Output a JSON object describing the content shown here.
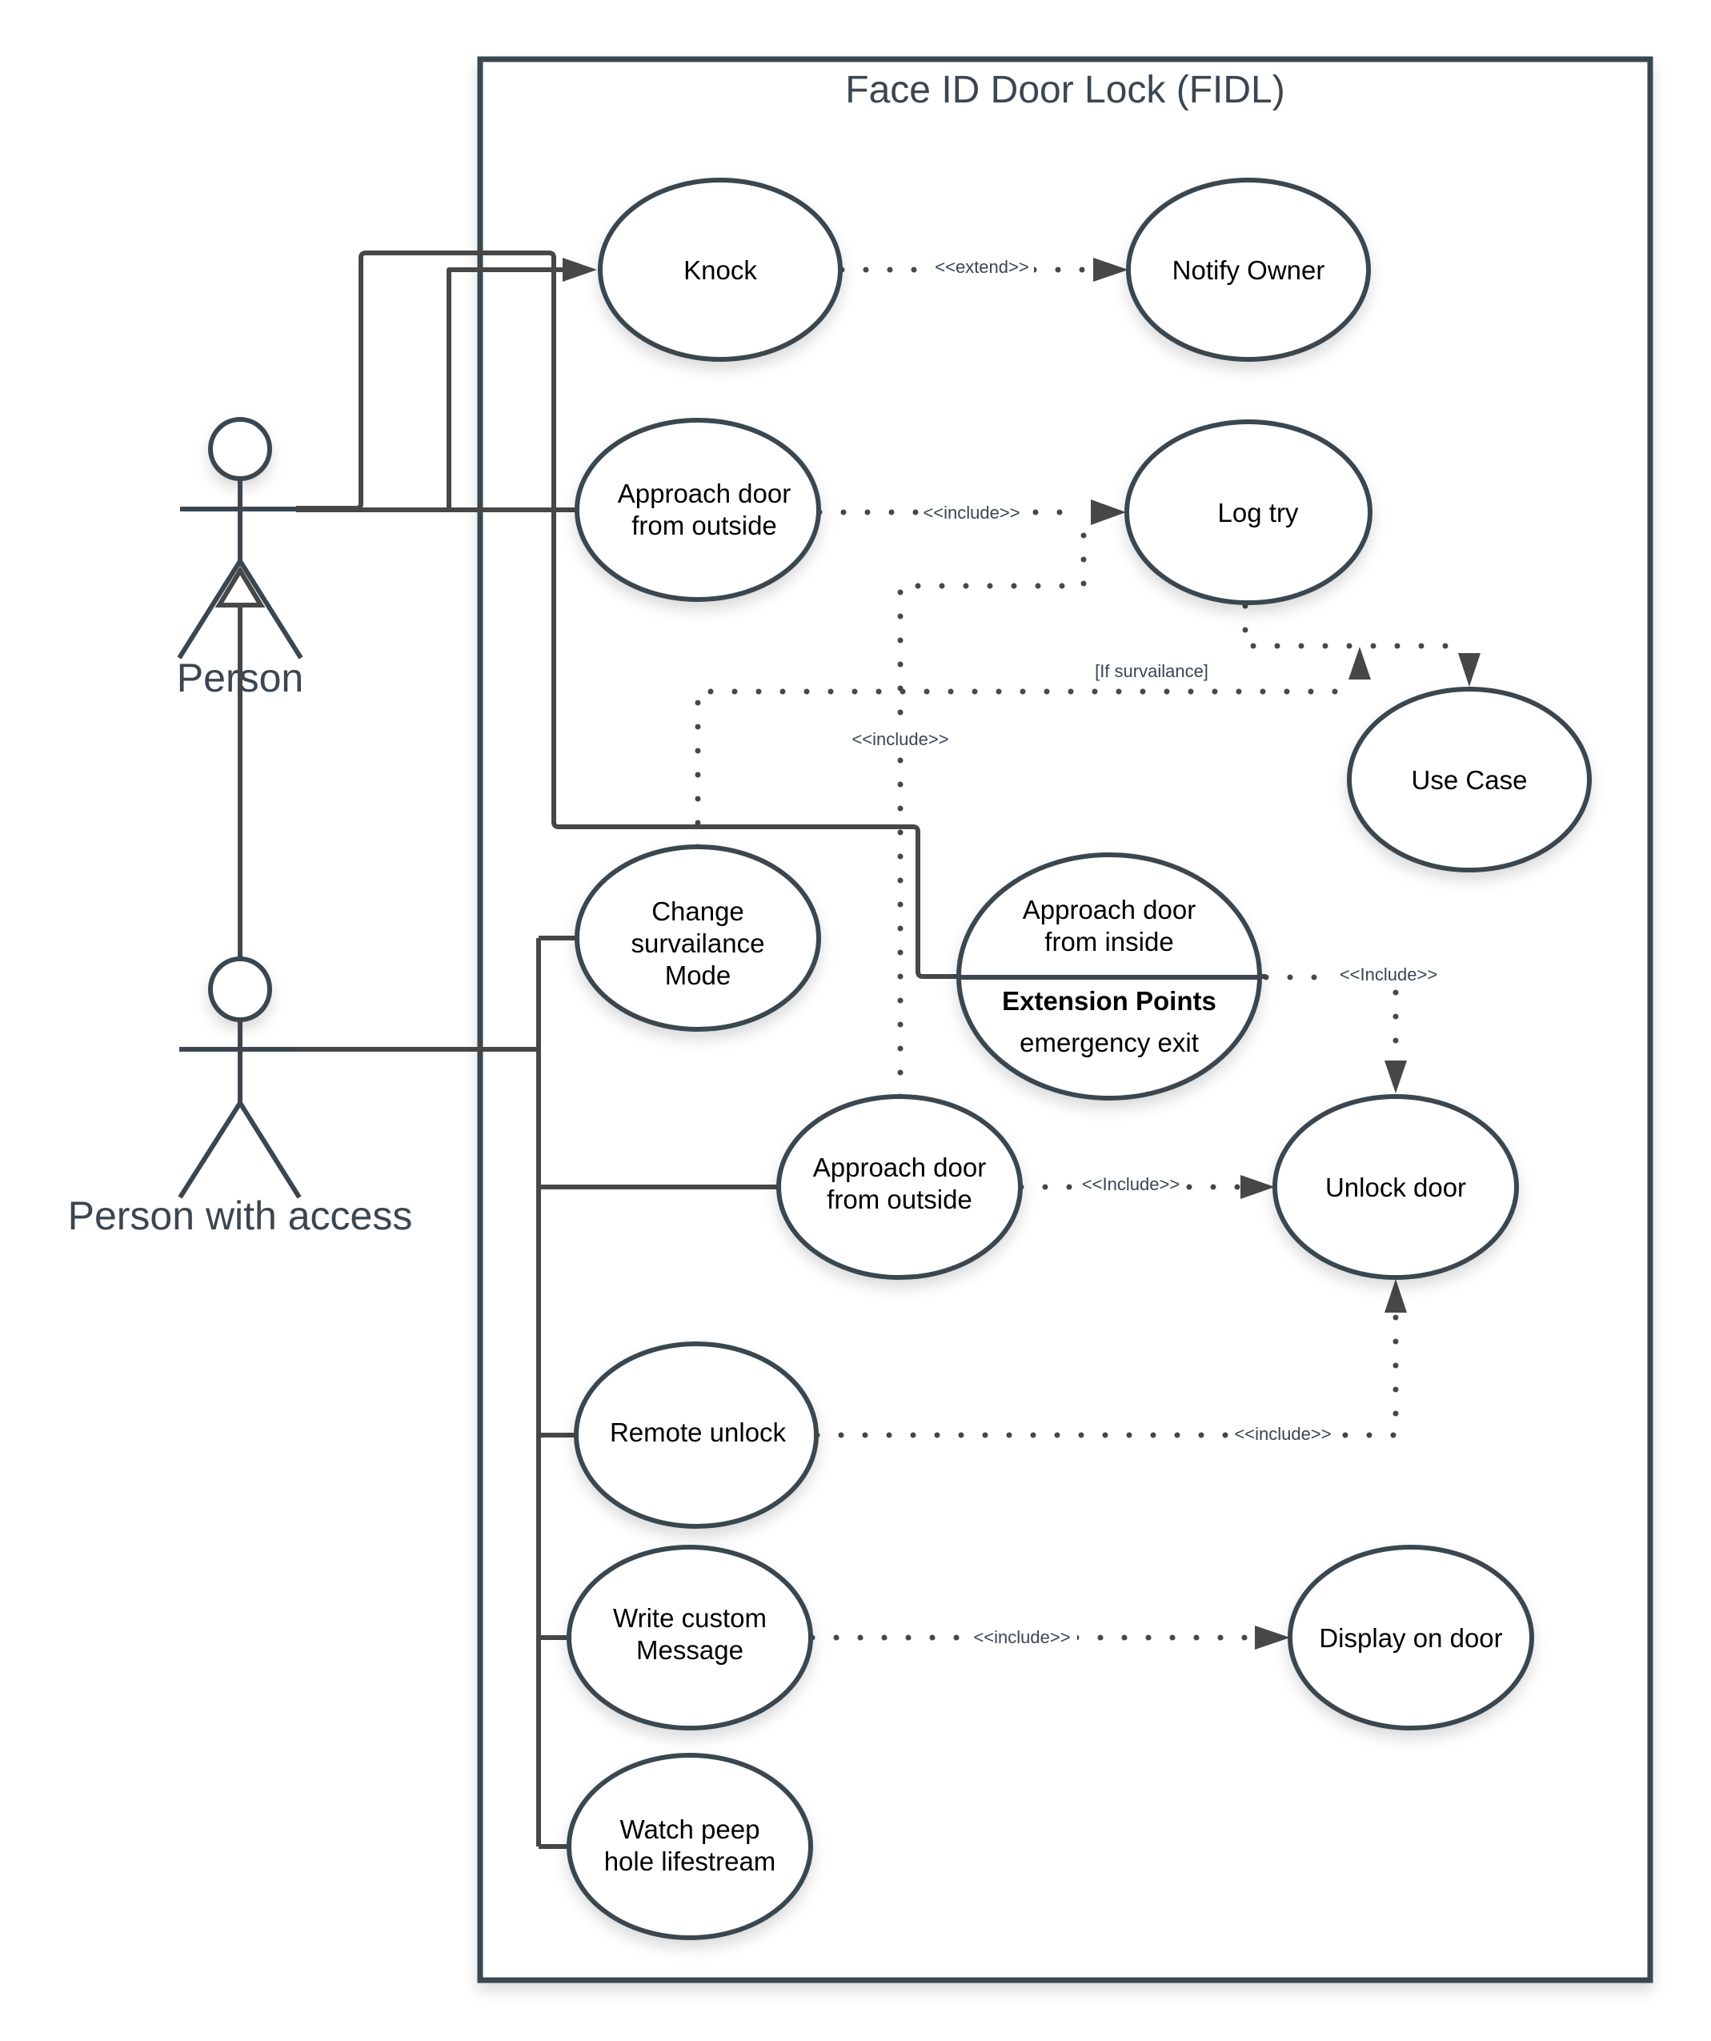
{
  "diagram": {
    "type": "UML use case diagram",
    "system_title": "Face ID Door Lock (FIDL)",
    "colors": {
      "stroke": "#3b4650",
      "connector": "#474747",
      "label": "#3a4654",
      "text": "#000000"
    },
    "actors": [
      {
        "id": "person",
        "label": "Person"
      },
      {
        "id": "person-with-access",
        "label": "Person with access"
      }
    ],
    "use_cases": [
      {
        "id": "knock",
        "lines": [
          "Knock"
        ]
      },
      {
        "id": "notify-owner",
        "lines": [
          "Notify Owner"
        ]
      },
      {
        "id": "approach-outside-1",
        "lines": [
          "Approach door",
          "from outside"
        ]
      },
      {
        "id": "log-try",
        "lines": [
          "Log try"
        ]
      },
      {
        "id": "use-case",
        "lines": [
          "Use Case"
        ]
      },
      {
        "id": "change-survailance",
        "lines": [
          "Change",
          "survailance",
          "Mode"
        ]
      },
      {
        "id": "approach-inside",
        "lines": [
          "Approach door",
          "from inside"
        ],
        "extension_points_title": "Extension Points",
        "extension_points": [
          "emergency exit"
        ]
      },
      {
        "id": "approach-outside-2",
        "lines": [
          "Approach door",
          "from outside"
        ]
      },
      {
        "id": "unlock-door",
        "lines": [
          "Unlock door"
        ]
      },
      {
        "id": "remote-unlock",
        "lines": [
          "Remote unlock"
        ]
      },
      {
        "id": "write-message",
        "lines": [
          "Write custom",
          "Message"
        ]
      },
      {
        "id": "display-on-door",
        "lines": [
          "Display on door"
        ]
      },
      {
        "id": "watch-peephole",
        "lines": [
          "Watch peep",
          "hole lifestream"
        ]
      }
    ],
    "relationships": [
      {
        "from": "knock",
        "to": "notify-owner",
        "label": "<<extend>>"
      },
      {
        "from": "approach-outside-1",
        "to": "log-try",
        "label": "<<include>>"
      },
      {
        "from": "approach-outside-2",
        "to": "log-try",
        "label": "<<include>>"
      },
      {
        "from": "log-try",
        "to": "use-case",
        "label": ""
      },
      {
        "from": "change-survailance",
        "to": "log-try-use-case-link",
        "label": "[If survailance]"
      },
      {
        "from": "approach-inside",
        "to": "unlock-door",
        "label": "<<Include>>"
      },
      {
        "from": "approach-outside-2",
        "to": "unlock-door",
        "label": "<<Include>>"
      },
      {
        "from": "remote-unlock",
        "to": "unlock-door",
        "label": "<<include>>"
      },
      {
        "from": "write-message",
        "to": "display-on-door",
        "label": "<<include>>"
      }
    ],
    "associations": [
      {
        "actor": "person",
        "use_case": "knock"
      },
      {
        "actor": "person",
        "use_case": "approach-outside-1"
      },
      {
        "actor": "person",
        "use_case": "approach-inside"
      },
      {
        "actor": "person-with-access",
        "use_case": "change-survailance"
      },
      {
        "actor": "person-with-access",
        "use_case": "approach-outside-2"
      },
      {
        "actor": "person-with-access",
        "use_case": "remote-unlock"
      },
      {
        "actor": "person-with-access",
        "use_case": "write-message"
      },
      {
        "actor": "person-with-access",
        "use_case": "watch-peephole"
      }
    ],
    "generalizations": [
      {
        "child": "person-with-access",
        "parent": "person"
      }
    ]
  }
}
